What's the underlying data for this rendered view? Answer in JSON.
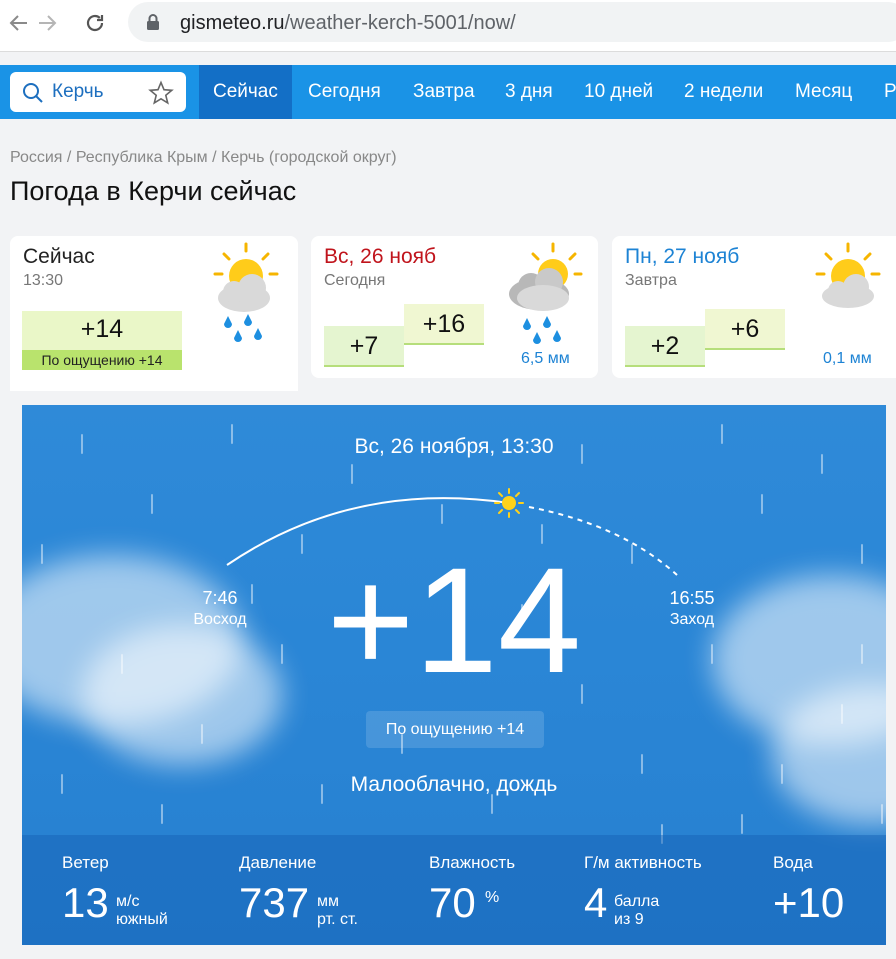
{
  "browser": {
    "url_host": "gismeteo.ru",
    "url_path": "/weather-kerch-5001/now/"
  },
  "search": {
    "value": "Керчь"
  },
  "nav": {
    "tabs": [
      {
        "label": "Сейчас",
        "active": true
      },
      {
        "label": "Сегодня"
      },
      {
        "label": "Завтра"
      },
      {
        "label": "3 дня"
      },
      {
        "label": "10 дней"
      },
      {
        "label": "2 недели"
      },
      {
        "label": "Месяц"
      },
      {
        "label": "Р"
      }
    ]
  },
  "breadcrumb": [
    "Россия",
    "Республика Крым",
    "Керчь (городской округ)"
  ],
  "page_title": "Погода в Керчи сейчас",
  "forecast_tabs": {
    "now": {
      "title": "Сейчас",
      "time": "13:30",
      "temp": "+14",
      "feels_like": "По ощущению +14"
    },
    "today": {
      "title": "Вс, 26 нояб",
      "subtitle": "Сегодня",
      "temp_min": "+7",
      "temp_max": "+16",
      "precip": "6,5 мм"
    },
    "tomorrow": {
      "title": "Пн, 27 нояб",
      "subtitle": "Завтра",
      "temp_min": "+2",
      "temp_max": "+6",
      "precip": "0,1 мм"
    }
  },
  "colors": {
    "title_red": "#c0141c",
    "title_blue": "#1d83d4",
    "nav_blue": "#1a93e6",
    "nav_active": "#136fc6"
  },
  "current": {
    "datetime": "Вс, 26 ноября, 13:30",
    "temp": "+14",
    "sunrise_time": "7:46",
    "sunrise_label": "Восход",
    "sunset_time": "16:55",
    "sunset_label": "Заход",
    "feels_like": "По ощущению +14",
    "description": "Малооблачно, дождь"
  },
  "stats": {
    "wind": {
      "label": "Ветер",
      "value": "13",
      "unit": "м/с",
      "direction": "южный"
    },
    "pressure": {
      "label": "Давление",
      "value": "737",
      "unit": "мм",
      "unit2": "рт. ст."
    },
    "humidity": {
      "label": "Влажность",
      "value": "70",
      "unit": "%"
    },
    "geomagnetic": {
      "label": "Г/м активность",
      "value": "4",
      "unit": "балла",
      "unit2": "из 9"
    },
    "water": {
      "label": "Вода",
      "value": "+10"
    }
  }
}
